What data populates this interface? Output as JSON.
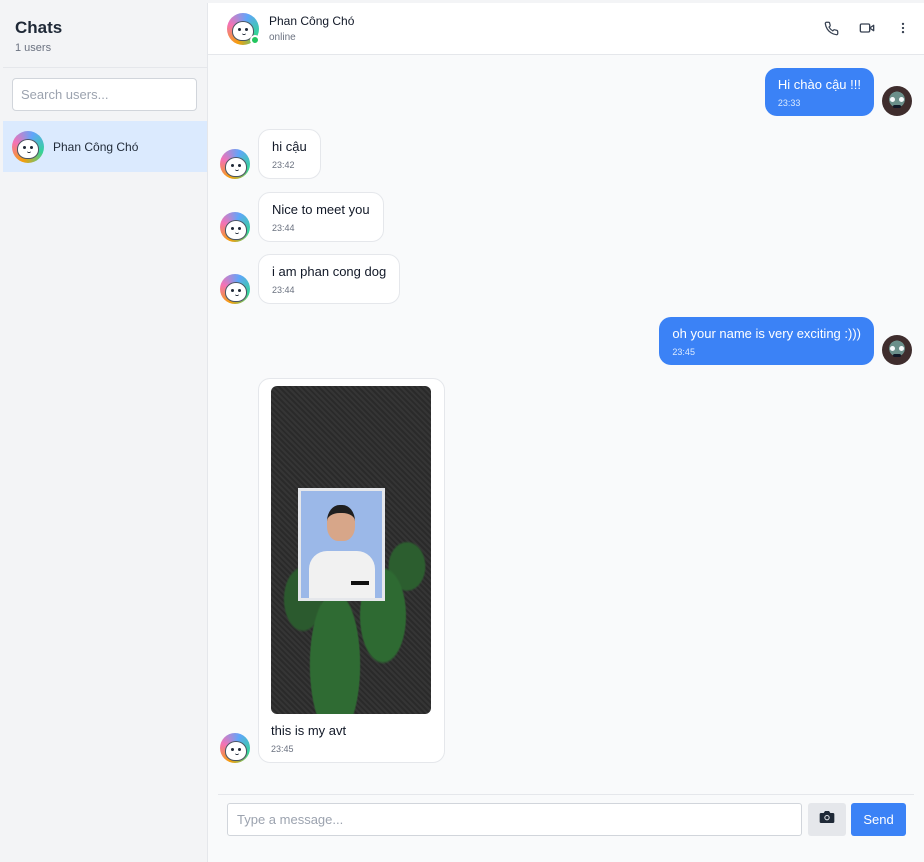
{
  "sidebar": {
    "title": "Chats",
    "user_count": "1 users",
    "search_placeholder": "Search users...",
    "users": [
      {
        "name": "Phan Công Chó",
        "active": true
      }
    ]
  },
  "chat_header": {
    "name": "Phan Công Chó",
    "status": "online",
    "actions": [
      "phone-icon",
      "video-icon",
      "more-vertical-icon"
    ]
  },
  "messages": [
    {
      "direction": "out",
      "text": "Hi chào cậu !!!",
      "time": "23:33"
    },
    {
      "direction": "in",
      "text": "hi cậu",
      "time": "23:42"
    },
    {
      "direction": "in",
      "text": "Nice to meet you",
      "time": "23:44"
    },
    {
      "direction": "in",
      "text": "i am phan cong dog",
      "time": "23:44"
    },
    {
      "direction": "out",
      "text": "oh your name is very exciting :)))",
      "time": "23:45"
    },
    {
      "direction": "in",
      "type": "image",
      "text": "this is my avt",
      "time": "23:45"
    }
  ],
  "composer": {
    "placeholder": "Type a message...",
    "send_label": "Send",
    "attach_icon": "camera-icon"
  },
  "colors": {
    "accent": "#3b82f6",
    "active_item": "#dbeafe",
    "online": "#22c55e"
  }
}
